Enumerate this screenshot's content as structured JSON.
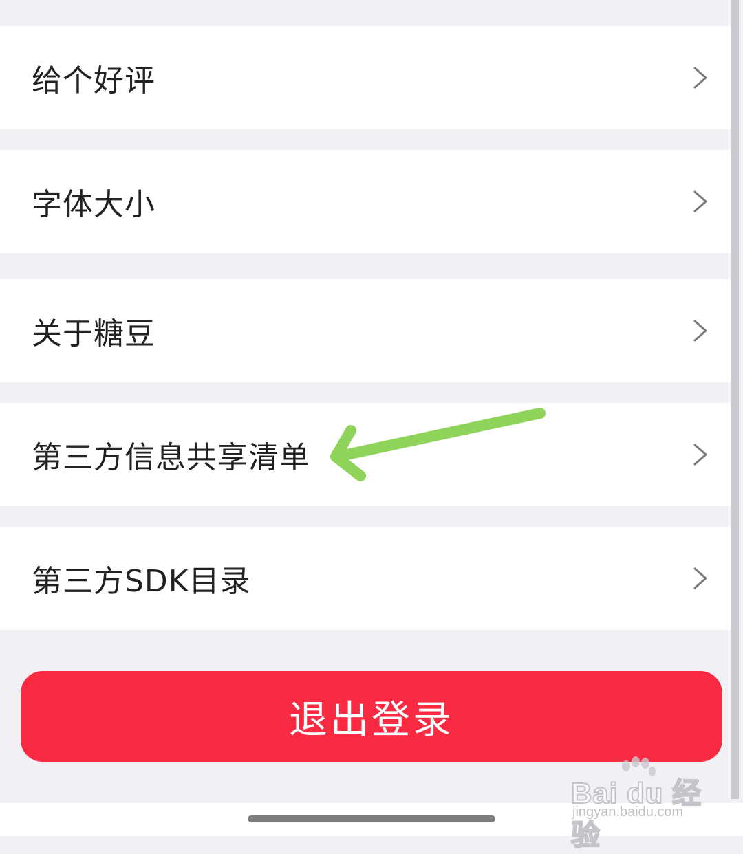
{
  "menu": {
    "items": [
      {
        "label": "给个好评",
        "icon": "chevron-right-icon"
      },
      {
        "label": "字体大小",
        "icon": "chevron-right-icon"
      },
      {
        "label": "关于糖豆",
        "icon": "chevron-right-icon"
      },
      {
        "label": "第三方信息共享清单",
        "icon": "chevron-right-icon"
      },
      {
        "label": "第三方SDK目录",
        "icon": "chevron-right-icon"
      }
    ]
  },
  "logout": {
    "label": "退出登录"
  },
  "watermark": {
    "brand": "Bai du 经验",
    "url": "jingyan.baidu.com"
  },
  "colors": {
    "page_background": "#f0f0f5",
    "row_background": "#ffffff",
    "logout_button": "#fb2a43",
    "annotation_arrow": "#8fd35b",
    "chevron": "#7a7a7a"
  }
}
